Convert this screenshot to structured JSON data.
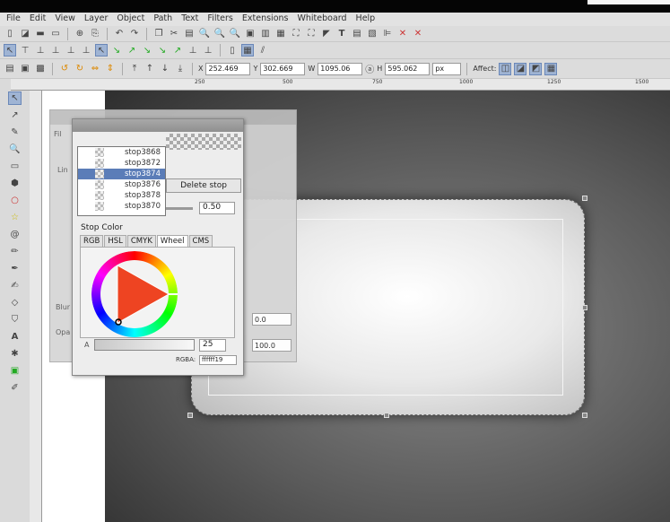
{
  "menu": [
    "File",
    "Edit",
    "View",
    "Layer",
    "Object",
    "Path",
    "Text",
    "Filters",
    "Extensions",
    "Whiteboard",
    "Help"
  ],
  "coords": {
    "x_label": "X",
    "x": "252.469",
    "y_label": "Y",
    "y": "302.669",
    "w_label": "W",
    "w": "1095.06",
    "h_label": "H",
    "h": "595.062",
    "unit": "px",
    "affect": "Affect:"
  },
  "ruler": [
    "250",
    "500",
    "750",
    "1000",
    "1250",
    "1500"
  ],
  "gradient": {
    "stops": [
      "stop3868",
      "stop3872",
      "stop3874",
      "stop3876",
      "stop3878",
      "stop3870"
    ],
    "selected_index": 2,
    "delete_label": "Delete stop",
    "offset": "0.50",
    "stop_color_label": "Stop Color",
    "tabs": [
      "RGB",
      "HSL",
      "CMYK",
      "Wheel",
      "CMS"
    ],
    "active_tab": "Wheel",
    "alpha_label": "A",
    "alpha": "25",
    "rgba_label": "RGBA:",
    "rgba": "ffffff19"
  },
  "fill_panel": {
    "blur": "0.0",
    "opacity": "100.0",
    "blur_label": "Blur",
    "opacity_label": "Opa",
    "linear_label": "Lin",
    "fill_label": "Fil"
  }
}
